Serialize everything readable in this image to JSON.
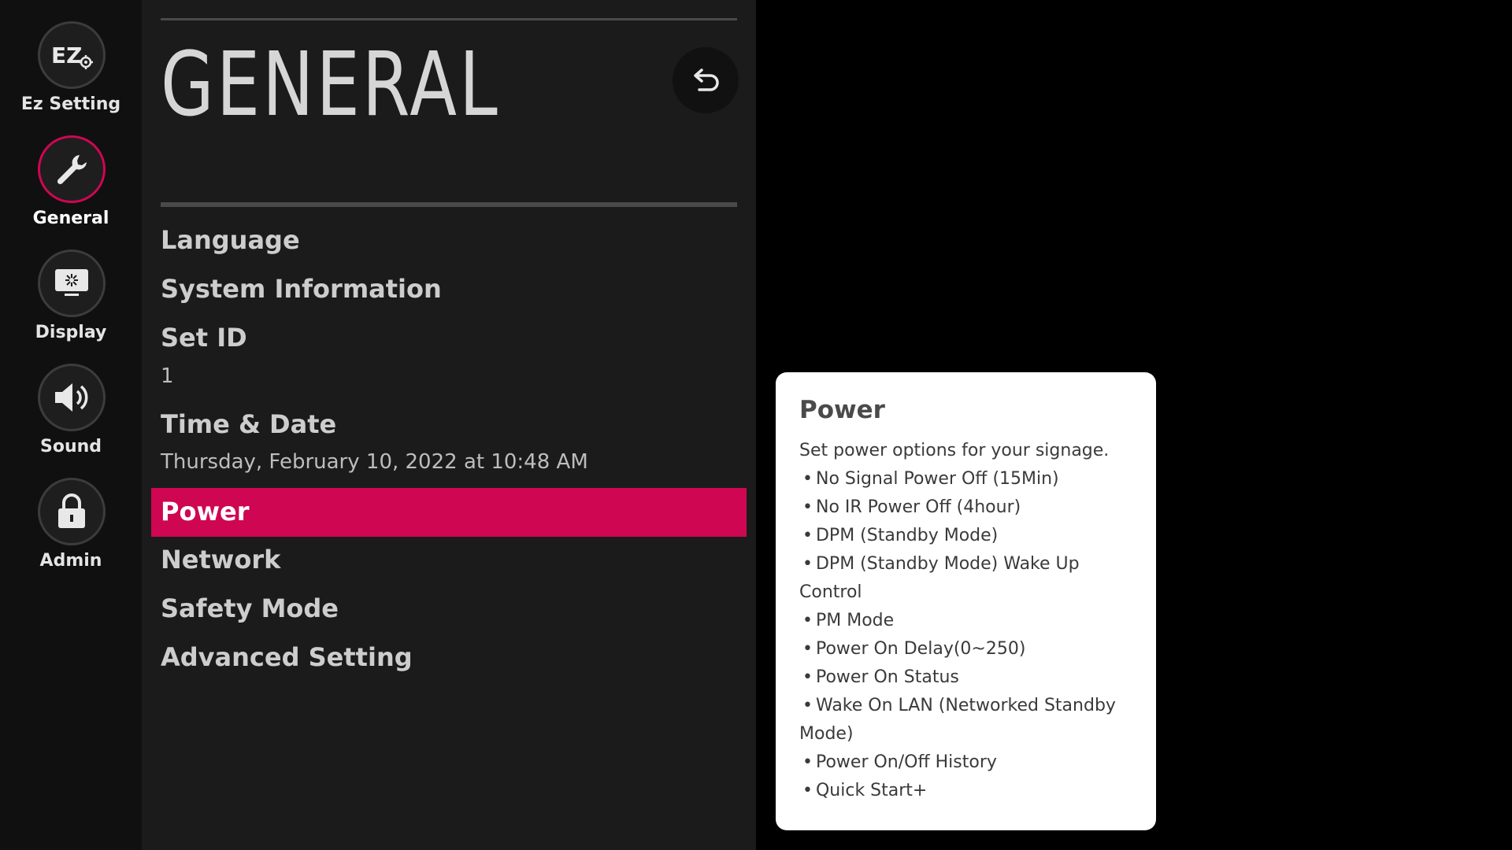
{
  "rail": {
    "items": [
      {
        "label": "Ez Setting",
        "icon": "ez-setting-icon",
        "active": false
      },
      {
        "label": "General",
        "icon": "wrench-icon",
        "active": true
      },
      {
        "label": "Display",
        "icon": "display-icon",
        "active": false
      },
      {
        "label": "Sound",
        "icon": "speaker-icon",
        "active": false
      },
      {
        "label": "Admin",
        "icon": "lock-icon",
        "active": false
      }
    ],
    "ez_glyph": "EZ"
  },
  "panel": {
    "title": "GENERAL",
    "back_icon": "back-arrow-icon",
    "menu": [
      {
        "label": "Language"
      },
      {
        "label": "System Information"
      },
      {
        "label": "Set ID",
        "value": "1"
      },
      {
        "label": "Time & Date",
        "value": "Thursday, February 10, 2022 at 10:48 AM"
      },
      {
        "label": "Power",
        "selected": true
      },
      {
        "label": "Network"
      },
      {
        "label": "Safety Mode"
      },
      {
        "label": "Advanced Setting"
      }
    ]
  },
  "help": {
    "title": "Power",
    "description": "Set power options for your signage.",
    "items": [
      "No Signal Power Off (15Min)",
      "No IR Power Off (4hour)",
      "DPM (Standby Mode)",
      "DPM (Standby Mode) Wake Up Control",
      "PM Mode",
      "Power On Delay(0~250)",
      "Power On Status",
      "Wake On LAN (Networked Standby Mode)",
      "Power On/Off History",
      "Quick Start+"
    ],
    "bullet": "•"
  },
  "colors": {
    "accent": "#cf0652",
    "panel_bg": "#1b1b1b",
    "rail_bg": "#101010",
    "card_bg": "#ffffff"
  }
}
